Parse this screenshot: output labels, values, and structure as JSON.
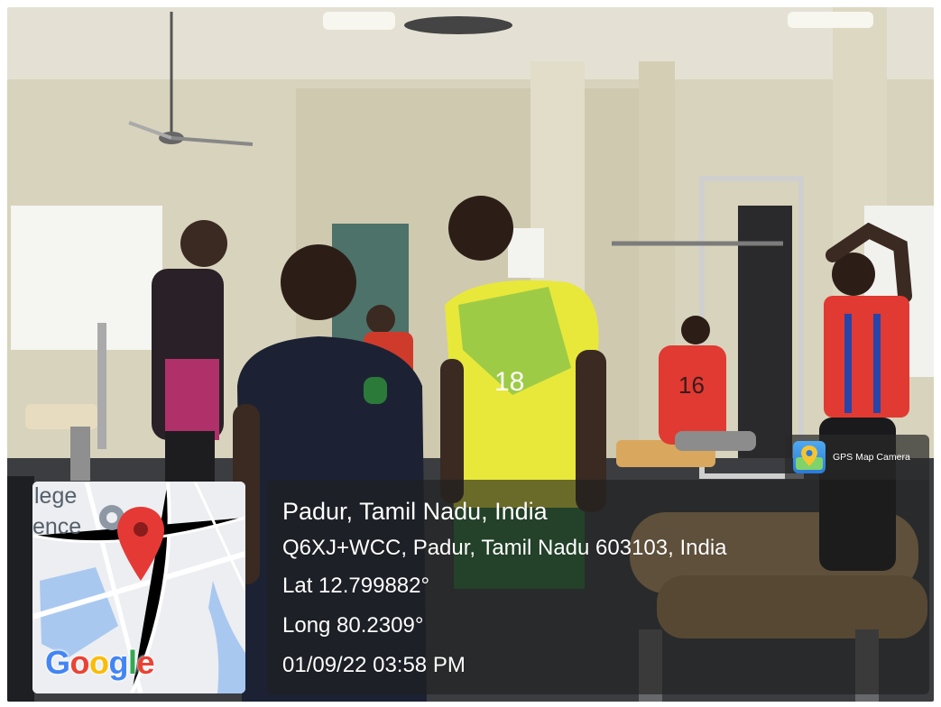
{
  "overlay": {
    "app_badge": "GPS Map Camera",
    "place_title": "Padur, Tamil Nadu, India",
    "address": "Q6XJ+WCC, Padur, Tamil Nadu 603103, India",
    "latitude": "Lat 12.799882°",
    "longitude": "Long 80.2309°",
    "datetime": "01/09/22 03:58 PM"
  },
  "minimap": {
    "label_line_1": "lege",
    "label_line_2": "ence",
    "logo_letters": [
      "G",
      "o",
      "o",
      "g",
      "l",
      "e"
    ],
    "logo_colors": [
      "#4285F4",
      "#EA4335",
      "#FBBC05",
      "#4285F4",
      "#34A853",
      "#EA4335"
    ],
    "pin_color": "#e53935",
    "icons": [
      "map-pin-icon",
      "location-marker-icon"
    ]
  },
  "jerseys": {
    "yellow_jersey_number": "18",
    "red_jersey_number": "16"
  },
  "colors": {
    "wall": "#d9d4bf",
    "floor": "#3b3d40",
    "yellow_jersey": "#e8e83a",
    "red_jersey": "#e03a32",
    "navy_jersey": "#1c2233"
  }
}
